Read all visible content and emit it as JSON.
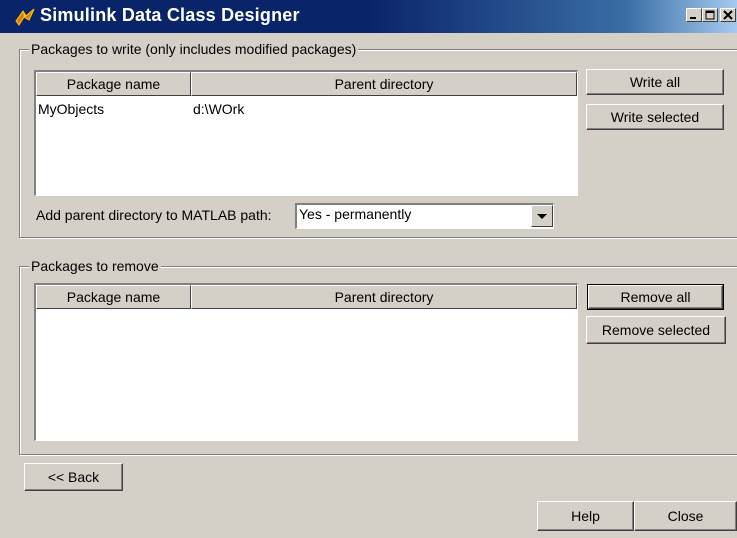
{
  "window": {
    "title": "Simulink Data Class Designer",
    "controls": [
      "minimize-icon",
      "maximize-icon",
      "close-icon"
    ]
  },
  "write_group": {
    "label": "Packages to write (only includes modified packages)",
    "columns": [
      "Package name",
      "Parent directory"
    ],
    "rows": [
      {
        "package": "MyObjects",
        "directory": "d:\\WOrk"
      }
    ],
    "write_all": "Write all",
    "write_selected": "Write selected",
    "path_label": "Add parent directory to MATLAB path:",
    "path_value": "Yes - permanently"
  },
  "remove_group": {
    "label": "Packages to remove",
    "columns": [
      "Package name",
      "Parent directory"
    ],
    "rows": [],
    "remove_all": "Remove all",
    "remove_selected": "Remove selected"
  },
  "footer": {
    "back": "<< Back",
    "help": "Help",
    "close": "Close"
  }
}
